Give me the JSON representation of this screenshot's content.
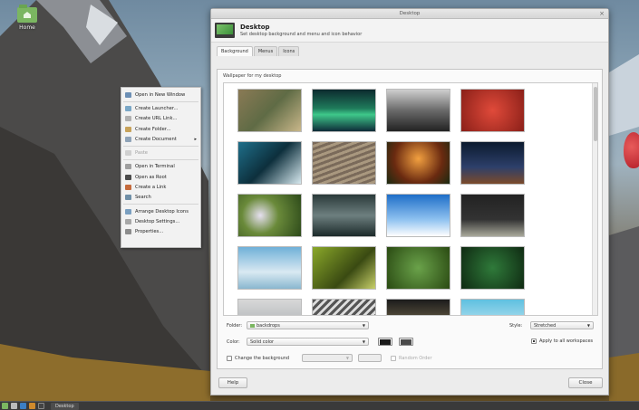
{
  "desktop": {
    "home_label": "Home",
    "accent": "#7bb661"
  },
  "context_menu": {
    "items": [
      {
        "label": "Open in New Window",
        "icon": "window-icon",
        "enabled": true
      },
      {
        "sep": true
      },
      {
        "label": "Create Launcher...",
        "icon": "launcher-icon",
        "enabled": true
      },
      {
        "label": "Create URL Link...",
        "icon": "link-icon",
        "enabled": true
      },
      {
        "label": "Create Folder...",
        "icon": "folder-icon",
        "enabled": true
      },
      {
        "label": "Create Document",
        "icon": "document-icon",
        "enabled": true,
        "submenu": true
      },
      {
        "sep": true
      },
      {
        "label": "Paste",
        "icon": "paste-icon",
        "enabled": false
      },
      {
        "sep": true
      },
      {
        "label": "Open in Terminal",
        "icon": "terminal-icon",
        "enabled": true
      },
      {
        "label": "Open as Root",
        "icon": "root-icon",
        "enabled": true
      },
      {
        "label": "Create a Link",
        "icon": "create-link-icon",
        "enabled": true
      },
      {
        "label": "Search",
        "icon": "search-icon",
        "enabled": true
      },
      {
        "sep": true
      },
      {
        "label": "Arrange Desktop Icons",
        "icon": "arrange-icon",
        "enabled": true
      },
      {
        "label": "Desktop Settings...",
        "icon": "settings-icon",
        "enabled": true
      },
      {
        "label": "Properties...",
        "icon": "properties-icon",
        "enabled": true
      }
    ]
  },
  "dialog": {
    "title": "Desktop",
    "header_title": "Desktop",
    "header_subtitle": "Set desktop background and menu and icon behavior",
    "tabs": [
      {
        "label": "Background",
        "active": true
      },
      {
        "label": "Menus",
        "active": false
      },
      {
        "label": "Icons",
        "active": false
      }
    ],
    "wallpaper_label": "Wallpaper for my desktop",
    "folder_label": "Folder:",
    "folder_value": "backdrops",
    "style_label": "Style:",
    "style_value": "Stretched",
    "color_label": "Color:",
    "color_value": "Solid color",
    "color1": "#1a1a1a",
    "color2": "#4a4a4a",
    "apply_all_label": "Apply to all workspaces",
    "change_bg_label": "Change the background",
    "interval_value": "",
    "interval_unit": "",
    "random_label": "Random Order",
    "help_label": "Help",
    "close_label": "Close"
  },
  "taskbar": {
    "task_label": "Desktop"
  }
}
